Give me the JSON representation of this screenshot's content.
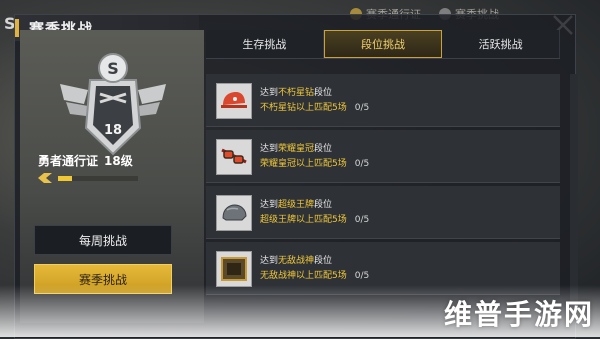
{
  "header": {
    "title": "赛季挑战",
    "top_tabs": [
      {
        "label": "赛季通行证"
      },
      {
        "label": "赛季挑战"
      }
    ]
  },
  "pass": {
    "name": "勇者通行证",
    "level": "18级",
    "emblem_number": "18",
    "emblem_letter": "S",
    "progress_fraction": 0.18
  },
  "buttons": {
    "weekly": "每周挑战",
    "season": "赛季挑战"
  },
  "tabs": [
    {
      "label": "生存挑战",
      "active": false
    },
    {
      "label": "段位挑战",
      "active": true
    },
    {
      "label": "活跃挑战",
      "active": false
    }
  ],
  "challenges": [
    {
      "title_pre": "达到",
      "title_hl": "不朽星钻",
      "title_post": "段位",
      "desc": "不朽星钻以上匹配5场",
      "count": "0/5",
      "icon": "cap-icon"
    },
    {
      "title_pre": "达到",
      "title_hl": "荣耀皇冠",
      "title_post": "段位",
      "desc": "荣耀皇冠以上匹配5场",
      "count": "0/5",
      "icon": "goggles-icon"
    },
    {
      "title_pre": "达到",
      "title_hl": "超级王牌",
      "title_post": "段位",
      "desc": "超级王牌以上匹配5场",
      "count": "0/5",
      "icon": "helmet-icon"
    },
    {
      "title_pre": "达到",
      "title_hl": "无敌战神",
      "title_post": "段位",
      "desc": "无敌战神以上匹配5场",
      "count": "0/5",
      "icon": "frame-icon"
    }
  ],
  "watermark": "维普手游网",
  "colors": {
    "accent": "#e6b93a",
    "highlight": "#f2c93a"
  }
}
